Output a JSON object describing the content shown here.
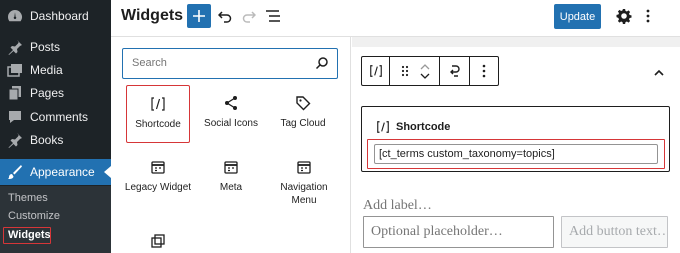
{
  "sidebar": {
    "items": [
      {
        "label": "Dashboard",
        "icon": "dashboard-icon"
      },
      {
        "label": "Posts",
        "icon": "pin-icon"
      },
      {
        "label": "Media",
        "icon": "media-icon"
      },
      {
        "label": "Pages",
        "icon": "pages-icon"
      },
      {
        "label": "Comments",
        "icon": "comments-icon"
      },
      {
        "label": "Books",
        "icon": "pin-icon"
      },
      {
        "label": "Appearance",
        "icon": "brush-icon",
        "active": true
      }
    ],
    "submenu": [
      {
        "label": "Themes"
      },
      {
        "label": "Customize"
      },
      {
        "label": "Widgets",
        "current": true
      }
    ]
  },
  "header": {
    "title": "Widgets",
    "update_label": "Update"
  },
  "inserter": {
    "search_placeholder": "Search",
    "blocks": [
      {
        "label": "Shortcode",
        "icon": "shortcode-icon",
        "selected": true
      },
      {
        "label": "Social Icons",
        "icon": "share-icon"
      },
      {
        "label": "Tag Cloud",
        "icon": "tag-icon"
      },
      {
        "label": "Legacy Widget",
        "icon": "calendar-icon"
      },
      {
        "label": "Meta",
        "icon": "calendar-icon"
      },
      {
        "label": "Navigation Menu",
        "icon": "calendar-icon"
      }
    ]
  },
  "canvas": {
    "block_title": "Shortcode",
    "shortcode_value": "[ct_terms custom_taxonomy=topics]",
    "add_label": "Add label…",
    "input_placeholder": "Optional placeholder…",
    "button_placeholder": "Add button text…"
  },
  "colors": {
    "admin_sidebar": "#1d2327",
    "accent": "#2271b1",
    "highlight": "#d63638"
  }
}
